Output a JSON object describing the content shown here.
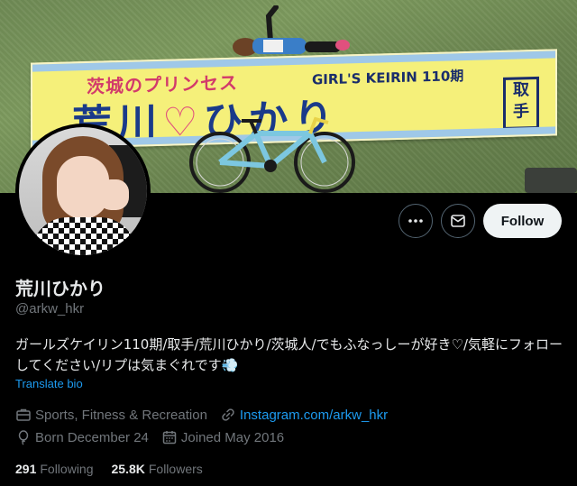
{
  "banner": {
    "sign_top_left": "茨城のプリンセス",
    "sign_top_right": "GIRL'S KEIRIN 110期",
    "sign_main_left": "荒川",
    "sign_heart": "♡",
    "sign_main_right": "ひかり",
    "sign_box": "取手"
  },
  "actions": {
    "more_icon": "more-horizontal-icon",
    "message_icon": "envelope-icon",
    "follow_label": "Follow"
  },
  "profile": {
    "name": "荒川ひかり",
    "handle": "@arkw_hkr",
    "bio": "ガールズケイリン110期/取手/荒川ひかり/茨城人/でもふなっしーが好き♡/気軽にフォローしてください/リプは気まぐれです💨",
    "translate_label": "Translate bio",
    "category": "Sports, Fitness & Recreation",
    "website": "Instagram.com/arkw_hkr",
    "birthday": "Born December 24",
    "joined": "Joined May 2016"
  },
  "stats": {
    "following_count": "291",
    "following_label": "Following",
    "followers_count": "25.8K",
    "followers_label": "Followers"
  },
  "colors": {
    "background": "#000000",
    "accent": "#1d9bf0",
    "muted": "#71767b",
    "text": "#e7e9ea"
  }
}
